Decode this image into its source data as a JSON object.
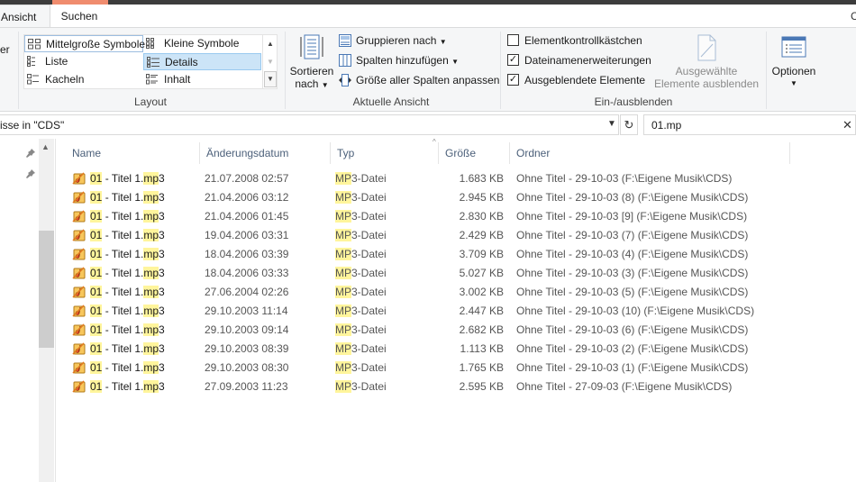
{
  "tabs": {
    "ansicht": "Ansicht",
    "suchen": "Suchen",
    "partial_right": "C"
  },
  "ribbon": {
    "left_partial": "er",
    "layout": {
      "items": [
        {
          "label": "Mittelgroße Symbole"
        },
        {
          "label": "Kleine Symbole"
        },
        {
          "label": "Liste"
        },
        {
          "label": "Details"
        },
        {
          "label": "Kacheln"
        },
        {
          "label": "Inhalt"
        }
      ],
      "group_label": "Layout"
    },
    "aktuelle_ansicht": {
      "sort_label_1": "Sortieren",
      "sort_label_2": "nach",
      "group_by": "Gruppieren nach",
      "add_columns": "Spalten hinzufügen",
      "fit_columns": "Größe aller Spalten anpassen",
      "group_label": "Aktuelle Ansicht"
    },
    "ein_ausblenden": {
      "checkboxes": [
        {
          "label": "Elementkontrollkästchen",
          "checked": false
        },
        {
          "label": "Dateinamenerweiterungen",
          "checked": true
        },
        {
          "label": "Ausgeblendete Elemente",
          "checked": true
        }
      ],
      "hide_selected_1": "Ausgewählte",
      "hide_selected_2": "Elemente ausblenden",
      "group_label": "Ein-/ausblenden"
    },
    "optionen": {
      "label": "Optionen"
    }
  },
  "address": {
    "path_text": "isse in \"CDS\"",
    "search_value": "01.mp"
  },
  "columns": {
    "name": "Name",
    "date": "Änderungsdatum",
    "type": "Typ",
    "size": "Größe",
    "folder": "Ordner"
  },
  "files": [
    {
      "name_hl1": "01",
      "name_mid": " - Titel 1.",
      "name_hl2": "mp",
      "name_end": "3",
      "date": "21.07.2008 02:57",
      "type_hl": "MP",
      "type_rest": "3-Datei",
      "size": "1.683 KB",
      "folder": "Ohne Titel - 29-10-03 (F:\\Eigene Musik\\CDS)"
    },
    {
      "name_hl1": "01",
      "name_mid": " - Titel 1.",
      "name_hl2": "mp",
      "name_end": "3",
      "date": "21.04.2006 03:12",
      "type_hl": "MP",
      "type_rest": "3-Datei",
      "size": "2.945 KB",
      "folder": "Ohne Titel - 29-10-03 (8) (F:\\Eigene Musik\\CDS)"
    },
    {
      "name_hl1": "01",
      "name_mid": " - Titel 1.",
      "name_hl2": "mp",
      "name_end": "3",
      "date": "21.04.2006 01:45",
      "type_hl": "MP",
      "type_rest": "3-Datei",
      "size": "2.830 KB",
      "folder": "Ohne Titel - 29-10-03 [9] (F:\\Eigene Musik\\CDS)"
    },
    {
      "name_hl1": "01",
      "name_mid": " - Titel 1.",
      "name_hl2": "mp",
      "name_end": "3",
      "date": "19.04.2006 03:31",
      "type_hl": "MP",
      "type_rest": "3-Datei",
      "size": "2.429 KB",
      "folder": "Ohne Titel - 29-10-03 (7) (F:\\Eigene Musik\\CDS)"
    },
    {
      "name_hl1": "01",
      "name_mid": " - Titel 1.",
      "name_hl2": "mp",
      "name_end": "3",
      "date": "18.04.2006 03:39",
      "type_hl": "MP",
      "type_rest": "3-Datei",
      "size": "3.709 KB",
      "folder": "Ohne Titel - 29-10-03 (4) (F:\\Eigene Musik\\CDS)"
    },
    {
      "name_hl1": "01",
      "name_mid": " - Titel 1.",
      "name_hl2": "mp",
      "name_end": "3",
      "date": "18.04.2006 03:33",
      "type_hl": "MP",
      "type_rest": "3-Datei",
      "size": "5.027 KB",
      "folder": "Ohne Titel - 29-10-03 (3) (F:\\Eigene Musik\\CDS)"
    },
    {
      "name_hl1": "01",
      "name_mid": " - Titel 1.",
      "name_hl2": "mp",
      "name_end": "3",
      "date": "27.06.2004 02:26",
      "type_hl": "MP",
      "type_rest": "3-Datei",
      "size": "3.002 KB",
      "folder": "Ohne Titel - 29-10-03 (5) (F:\\Eigene Musik\\CDS)"
    },
    {
      "name_hl1": "01",
      "name_mid": " - Titel 1.",
      "name_hl2": "mp",
      "name_end": "3",
      "date": "29.10.2003 11:14",
      "type_hl": "MP",
      "type_rest": "3-Datei",
      "size": "2.447 KB",
      "folder": "Ohne Titel - 29-10-03 (10) (F:\\Eigene Musik\\CDS)"
    },
    {
      "name_hl1": "01",
      "name_mid": " - Titel 1.",
      "name_hl2": "mp",
      "name_end": "3",
      "date": "29.10.2003 09:14",
      "type_hl": "MP",
      "type_rest": "3-Datei",
      "size": "2.682 KB",
      "folder": "Ohne Titel - 29-10-03 (6) (F:\\Eigene Musik\\CDS)"
    },
    {
      "name_hl1": "01",
      "name_mid": " - Titel 1.",
      "name_hl2": "mp",
      "name_end": "3",
      "date": "29.10.2003 08:39",
      "type_hl": "MP",
      "type_rest": "3-Datei",
      "size": "1.113 KB",
      "folder": "Ohne Titel - 29-10-03 (2) (F:\\Eigene Musik\\CDS)"
    },
    {
      "name_hl1": "01",
      "name_mid": " - Titel 1.",
      "name_hl2": "mp",
      "name_end": "3",
      "date": "29.10.2003 08:30",
      "type_hl": "MP",
      "type_rest": "3-Datei",
      "size": "1.765 KB",
      "folder": "Ohne Titel - 29-10-03 (1) (F:\\Eigene Musik\\CDS)"
    },
    {
      "name_hl1": "01",
      "name_mid": " - Titel 1.",
      "name_hl2": "mp",
      "name_end": "3",
      "date": "27.09.2003 11:23",
      "type_hl": "MP",
      "type_rest": "3-Datei",
      "size": "2.595 KB",
      "folder": "Ohne Titel - 27-09-03 (F:\\Eigene Musik\\CDS)"
    }
  ],
  "colors": {
    "highlight": "#fff59c",
    "selection": "#cce4f7",
    "header_text": "#4c607a",
    "accent_tab": "#f08c6e"
  }
}
